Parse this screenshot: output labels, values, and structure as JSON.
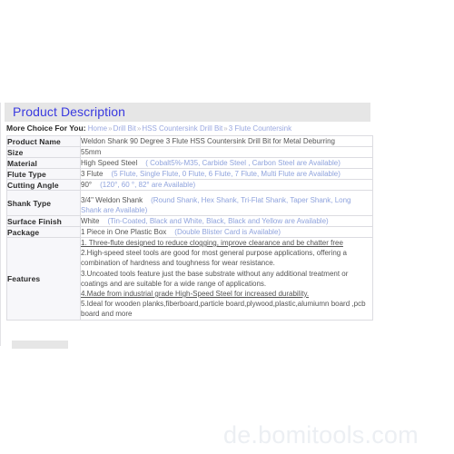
{
  "watermark": "de.bomitools.com",
  "section": {
    "title": "Product Description"
  },
  "breadcrumb": {
    "label": "More Choice For You:",
    "items": [
      "Home",
      "Drill Bit",
      "HSS Countersink Drill Bit",
      "3 Flute Countersink"
    ],
    "separator": "»"
  },
  "spec_table": {
    "rows": [
      {
        "key": "Product Name",
        "value": "Weldon Shank 90 Degree 3 Flute HSS Countersink Drill Bit  for Metal Deburring",
        "options": ""
      },
      {
        "key": "Size",
        "value": "55mm",
        "options": ""
      },
      {
        "key": "Material",
        "value": "High Speed Steel",
        "options": "( Cobalt5%-M35, Carbide Steel , Carbon Steel are Available)"
      },
      {
        "key": "Flute Type",
        "value": "3 Flute",
        "options": "(5 Flute, Single Flute, 0 Flute,  6 Flute, 7 Flute, Multi Flute are Available)"
      },
      {
        "key": "Cutting Angle",
        "value": "90°",
        "options": "(120°, 60 °, 82° are Available)"
      },
      {
        "key": "Shank Type",
        "value": "3/4\" Weldon Shank",
        "options": "(Round Shank, Hex Shank,  Tri-Flat Shank, Taper Shank,  Long Shank  are Available)"
      },
      {
        "key": "Surface Finish",
        "value": "White",
        "options": "(Tin-Coated, Black and White, Black, Black and Yellow are Available)"
      },
      {
        "key": "Package",
        "value": "1 Piece in One Plastic Box",
        "options": "(Double Blister Card is Available)"
      }
    ],
    "features": {
      "key": "Features",
      "lines": [
        "1. Three-flute designed to reduce clogging, improve clearance and be chatter free",
        "2.High-speed steel tools are good for most general purpose applications, offering a combination of hardness and toughness for wear resistance.",
        "3.Uncoated tools feature just the base substrate without any additional treatment or coatings and are suitable for a wide range of applications.",
        "4.Made from industrial grade High-Speed Steel for increased durability.",
        "5.Ideal for wooden planks,fiberboard,particle board,plywood,plastic,alumiumn board ,pcb board and more"
      ],
      "underlined": [
        0,
        3
      ]
    }
  },
  "clipped_section": {
    "text": ""
  },
  "colors": {
    "header_bar": "#e6e6e6",
    "title_blue": "#3a3ae0",
    "option_blue": "#8fa3dd",
    "link_blue": "#9aa8e0",
    "table_border": "#dcdce1",
    "key_cell_bg": "#f7f7fa",
    "watermark": "#eceff3"
  }
}
